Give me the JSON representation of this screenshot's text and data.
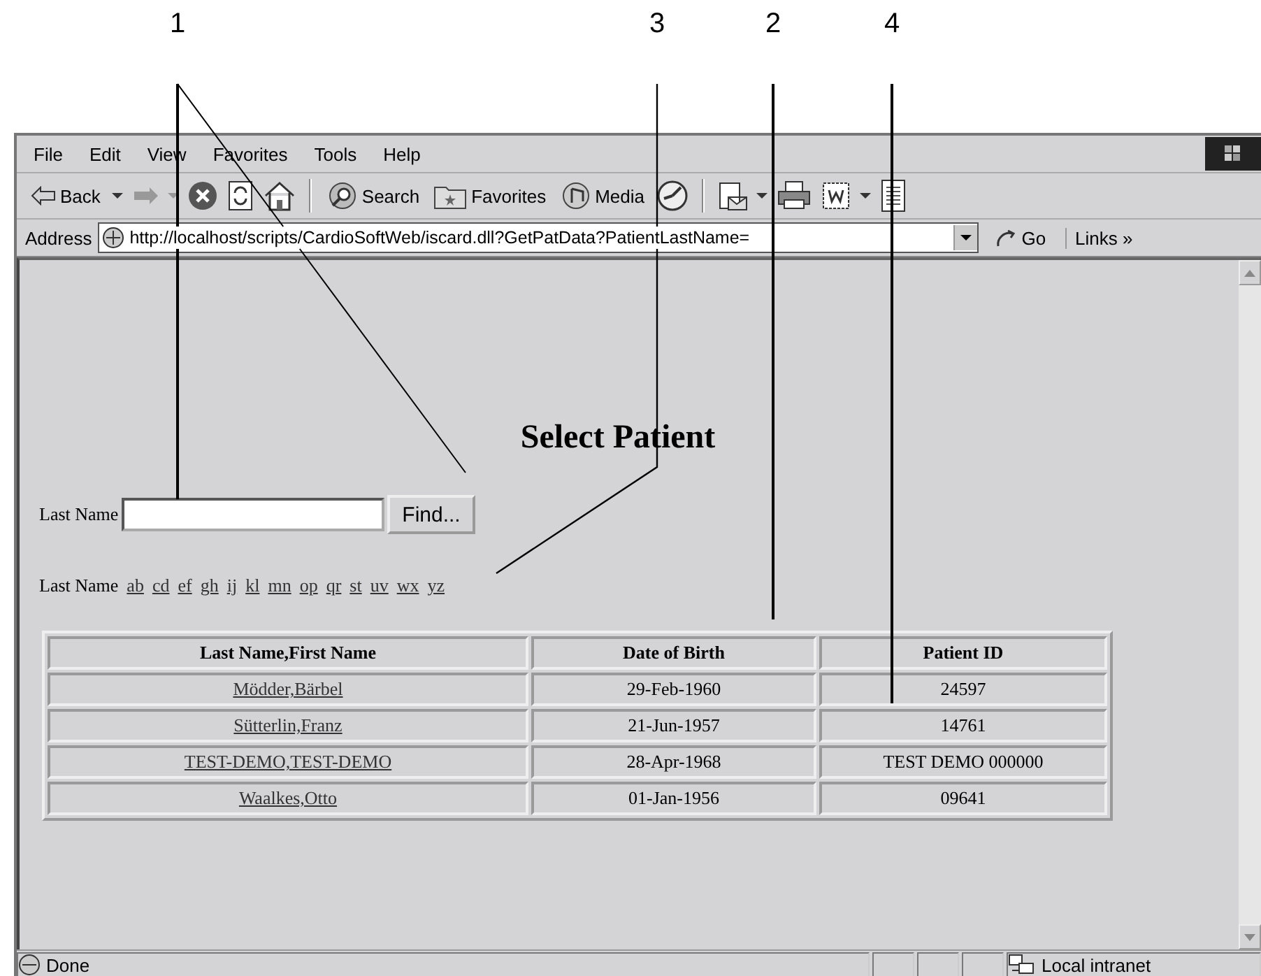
{
  "callouts": [
    {
      "label": "1"
    },
    {
      "label": "3"
    },
    {
      "label": "2"
    },
    {
      "label": "4"
    }
  ],
  "menu": [
    "File",
    "Edit",
    "View",
    "Favorites",
    "Tools",
    "Help"
  ],
  "toolbar": {
    "back": "Back",
    "search": "Search",
    "favorites": "Favorites",
    "media": "Media"
  },
  "address_bar": {
    "label": "Address",
    "url": "http://localhost/scripts/CardioSoftWeb/iscard.dll?GetPatData?PatientLastName=",
    "go": "Go",
    "links": "Links »"
  },
  "page": {
    "title": "Select Patient",
    "search": {
      "label": "Last Name",
      "button": "Find..."
    },
    "letters": {
      "label": "Last Name",
      "links": [
        "ab",
        "cd",
        "ef",
        "gh",
        "ij",
        "kl",
        "mn",
        "op",
        "qr",
        "st",
        "uv",
        "wx",
        "yz"
      ]
    },
    "table": {
      "columns": [
        "Last Name,First Name",
        "Date of Birth",
        "Patient ID"
      ],
      "rows": [
        [
          "Mödder,Bärbel",
          "29-Feb-1960",
          "24597"
        ],
        [
          "Sütterlin,Franz",
          "21-Jun-1957",
          "14761"
        ],
        [
          "TEST-DEMO,TEST-DEMO",
          "28-Apr-1968",
          "TEST DEMO 000000"
        ],
        [
          "Waalkes,Otto",
          "01-Jan-1956",
          "09641"
        ]
      ]
    }
  },
  "status_bar": {
    "text": "Done",
    "zone": "Local intranet"
  }
}
